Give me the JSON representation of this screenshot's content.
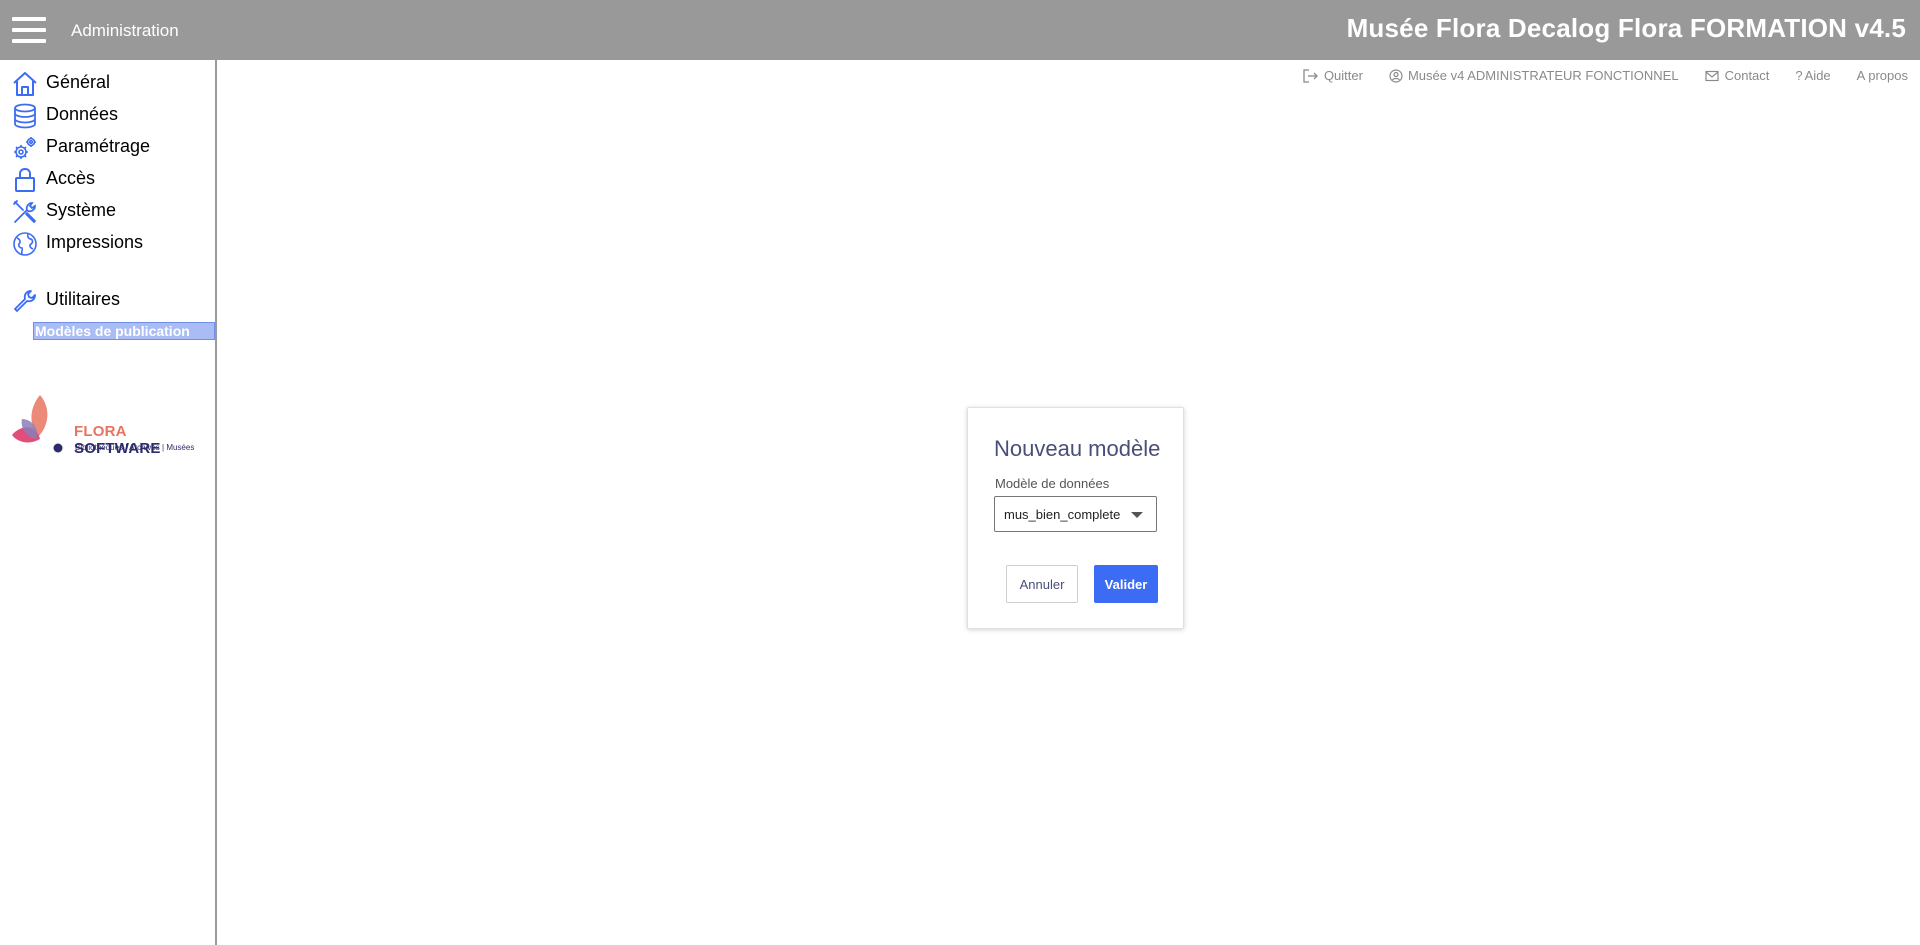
{
  "header": {
    "menu_icon": "hamburger-menu-icon",
    "section": "Administration",
    "title": "Musée Flora Decalog Flora FORMATION v4.5",
    "background": "#999999"
  },
  "sidebar": {
    "items": [
      {
        "label": "Général",
        "icon": "home-icon"
      },
      {
        "label": "Données",
        "icon": "database-icon"
      },
      {
        "label": "Paramétrage",
        "icon": "gears-icon"
      },
      {
        "label": "Accès",
        "icon": "lock-icon"
      },
      {
        "label": "Système",
        "icon": "tools-icon"
      },
      {
        "label": "Impressions",
        "icon": "globe-icon"
      },
      {
        "label": "Utilitaires",
        "icon": "wrench-icon"
      }
    ],
    "active_subitem": "Modèles de publication",
    "logo": {
      "flora": "FLORA",
      "software": "SOFTWARE",
      "tagline": "Bibliothèques | Archives | Musées"
    }
  },
  "top_links": {
    "quit": "Quitter",
    "user": "Musée v4 ADMINISTRATEUR FONCTIONNEL",
    "contact": "Contact",
    "help": "Aide",
    "about": "A propos"
  },
  "dialog": {
    "title": "Nouveau modèle",
    "field_label": "Modèle de données",
    "select_value": "mus_bien_complete",
    "cancel_label": "Annuler",
    "ok_label": "Valider"
  },
  "colors": {
    "accent": "#3d6cf4",
    "icon": "#3d6cf4",
    "selection": "#a9bcf5"
  }
}
